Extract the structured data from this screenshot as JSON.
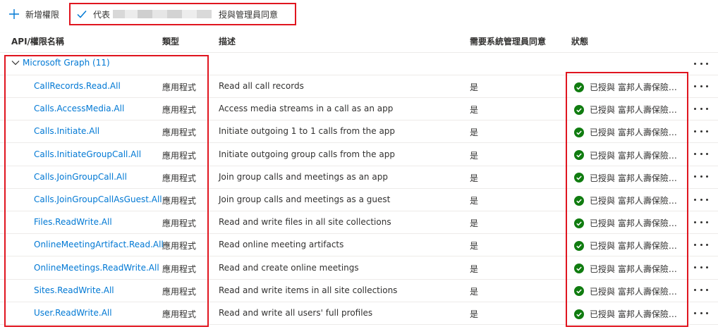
{
  "toolbar": {
    "add_label": "新增權限",
    "grant_prefix": "代表",
    "grant_suffix": "授與管理員同意"
  },
  "columns": {
    "name": "API/權限名稱",
    "type": "類型",
    "description": "描述",
    "admin_consent": "需要系統管理員同意",
    "status": "狀態"
  },
  "group": {
    "label": "Microsoft Graph (11)"
  },
  "rows": [
    {
      "name": "CallRecords.Read.All",
      "type": "應用程式",
      "description": "Read all call records",
      "admin": "是",
      "status": "已授與 富邦人壽保險股..."
    },
    {
      "name": "Calls.AccessMedia.All",
      "type": "應用程式",
      "description": "Access media streams in a call as an app",
      "admin": "是",
      "status": "已授與 富邦人壽保險股..."
    },
    {
      "name": "Calls.Initiate.All",
      "type": "應用程式",
      "description": "Initiate outgoing 1 to 1 calls from the app",
      "admin": "是",
      "status": "已授與 富邦人壽保險股..."
    },
    {
      "name": "Calls.InitiateGroupCall.All",
      "type": "應用程式",
      "description": "Initiate outgoing group calls from the app",
      "admin": "是",
      "status": "已授與 富邦人壽保險股..."
    },
    {
      "name": "Calls.JoinGroupCall.All",
      "type": "應用程式",
      "description": "Join group calls and meetings as an app",
      "admin": "是",
      "status": "已授與 富邦人壽保險股..."
    },
    {
      "name": "Calls.JoinGroupCallAsGuest.All",
      "type": "應用程式",
      "description": "Join group calls and meetings as a guest",
      "admin": "是",
      "status": "已授與 富邦人壽保險股..."
    },
    {
      "name": "Files.ReadWrite.All",
      "type": "應用程式",
      "description": "Read and write files in all site collections",
      "admin": "是",
      "status": "已授與 富邦人壽保險股..."
    },
    {
      "name": "OnlineMeetingArtifact.Read.All",
      "type": "應用程式",
      "description": "Read online meeting artifacts",
      "admin": "是",
      "status": "已授與 富邦人壽保險股..."
    },
    {
      "name": "OnlineMeetings.ReadWrite.All",
      "type": "應用程式",
      "description": "Read and create online meetings",
      "admin": "是",
      "status": "已授與 富邦人壽保險股..."
    },
    {
      "name": "Sites.ReadWrite.All",
      "type": "應用程式",
      "description": "Read and write items in all site collections",
      "admin": "是",
      "status": "已授與 富邦人壽保險股..."
    },
    {
      "name": "User.ReadWrite.All",
      "type": "應用程式",
      "description": "Read and write all users' full profiles",
      "admin": "是",
      "status": "已授與 富邦人壽保險股..."
    }
  ],
  "colors": {
    "accent": "#0078d4",
    "success": "#107c10",
    "highlight": "#e0151f"
  }
}
